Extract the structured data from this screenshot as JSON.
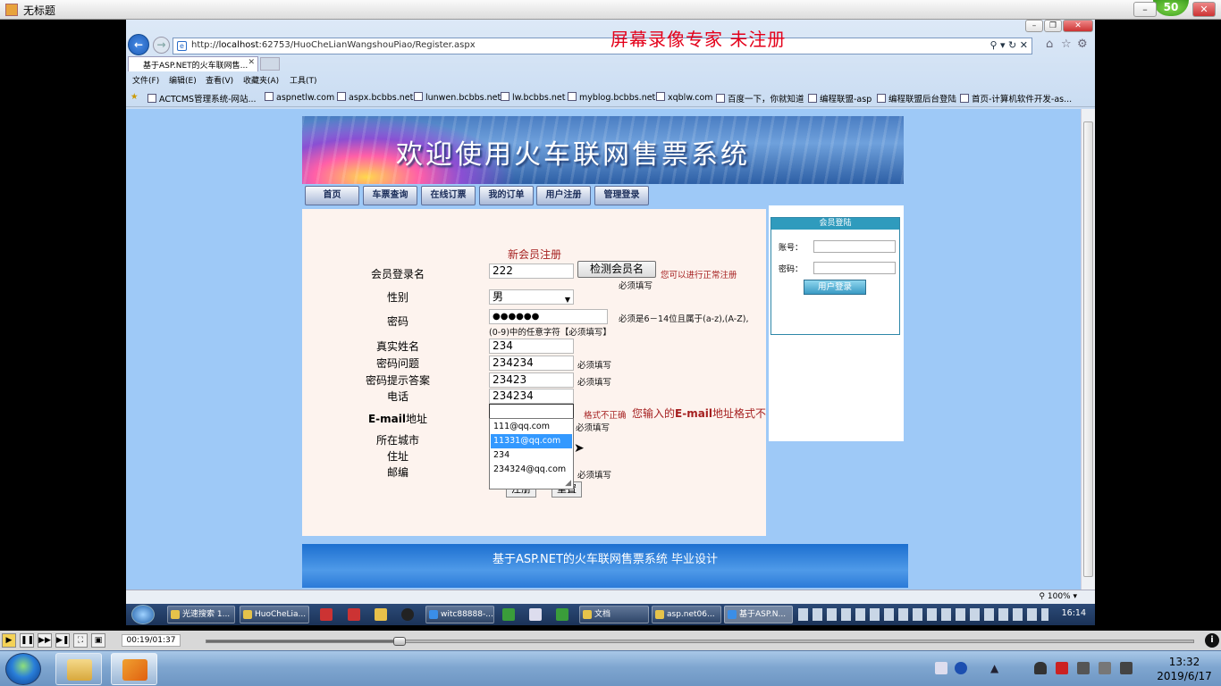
{
  "player": {
    "title": "无标题",
    "badge": "50",
    "timecode": "00:19/01:37",
    "progress": 0.196
  },
  "browser": {
    "url_prefix": "http://",
    "url_host": "localhost",
    "url_rest": ":62753/HuoCheLianWangshouPiao/Register.aspx",
    "tab_title": "基于ASP.NET的火车联网售...",
    "watermark": "屏幕录像专家  未注册",
    "menu": [
      "文件(F)",
      "编辑(E)",
      "查看(V)",
      "收藏夹(A)",
      "工具(T)"
    ],
    "favorites": [
      "ACTCMS管理系统-网站...",
      "aspnetlw.com",
      "aspx.bcbbs.net",
      "lunwen.bcbbs.net",
      "lw.bcbbs.net",
      "myblog.bcbbs.net",
      "xqblw.com",
      "百度一下，你就知道",
      "编程联盟-asp",
      "编程联盟后台登陆",
      "首页-计算机软件开发-as..."
    ],
    "zoom": "100%"
  },
  "site": {
    "banner_title": "欢迎使用火车联网售票系统",
    "nav": [
      "首页",
      "车票查询",
      "在线订票",
      "我的订单",
      "用户注册",
      "管理登录"
    ],
    "footer": "基于ASP.NET的火车联网售票系统  毕业设计",
    "login": {
      "header": "会员登陆",
      "account_label": "账号：",
      "password_label": "密码：",
      "button": "用户登录"
    }
  },
  "form": {
    "title": "新会员注册",
    "labels": {
      "username": "会员登录名",
      "gender": "性别",
      "password": "密码",
      "realname": "真实姓名",
      "question": "密码问题",
      "answer": "密码提示答案",
      "phone": "电话",
      "email_en": "E-mail",
      "email_cn": "地址",
      "city": "所在城市",
      "address": "住址",
      "zip": "邮编"
    },
    "values": {
      "username": "222",
      "gender": "男",
      "password": "●●●●●●",
      "realname": "234",
      "question": "234234",
      "answer": "23423",
      "phone": "234234",
      "email": ""
    },
    "check_button": "检测会员名",
    "username_ok": "您可以进行正常注册",
    "required": "必须填写",
    "password_hint1": "必须是6－14位且属于(a-z),(A-Z),",
    "password_hint2": "(0-9)中的任意字符【必须填写】",
    "email_error_small": "格式不正确",
    "email_error_pre": "您输入的",
    "email_error_mid": "E-mail",
    "email_error_post": "地址格式不",
    "autocomplete": [
      "111@qq.com",
      "11331@qq.com",
      "234",
      "234324@qq.com"
    ],
    "submit": "注册",
    "reset": "重置"
  },
  "inner_taskbar": {
    "buttons": [
      "光速搜索 1...",
      "HuoCheLia...",
      "witc88888-...",
      "文档",
      "asp.net06...",
      "基于ASP.N..."
    ],
    "clock": "16:14"
  },
  "taskbar": {
    "time": "13:32",
    "date": "2019/6/17"
  }
}
